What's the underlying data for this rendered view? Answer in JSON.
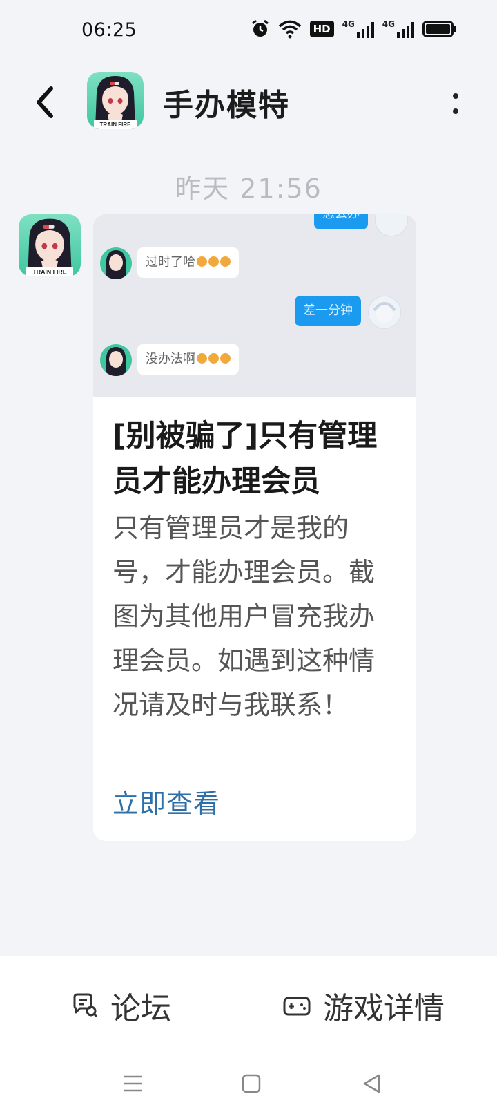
{
  "status_bar": {
    "time": "06:25",
    "icons": [
      "alarm-icon",
      "wifi-icon",
      "hd-icon",
      "signal-4g-icon",
      "signal-4g-icon",
      "battery-icon"
    ],
    "hd_label": "HD",
    "net_label": "4G"
  },
  "header": {
    "title": "手办模特",
    "avatar_caption": "TRAIN FIRE",
    "back_icon": "chevron-left-icon",
    "more_icon": "more-vertical-icon"
  },
  "conversation": {
    "timestamp": "昨天  21:56",
    "sender_avatar_caption": "TRAIN FIRE",
    "card": {
      "image_chat": [
        {
          "side": "right",
          "text": "怎么办"
        },
        {
          "side": "left",
          "text": "过时了哈"
        },
        {
          "side": "right",
          "text": "差一分钟"
        },
        {
          "side": "left",
          "text": "没办法啊"
        }
      ],
      "title": "[别被骗了]只有管理员才能办理会员",
      "description": "只有管理员才是我的号，才能办理会员。截图为其他用户冒充我办理会员。如遇到这种情况请及时与我联系！",
      "link": "立即查看"
    }
  },
  "bottom_tabs": [
    {
      "label": "论坛",
      "icon": "forum-chat-icon"
    },
    {
      "label": "游戏详情",
      "icon": "gamepad-icon"
    }
  ],
  "system_nav": [
    "menu-icon",
    "home-square-icon",
    "back-triangle-icon"
  ],
  "colors": {
    "background": "#f3f4f8",
    "accent_blue": "#1b9bf0",
    "link_blue": "#2e6fa8"
  }
}
